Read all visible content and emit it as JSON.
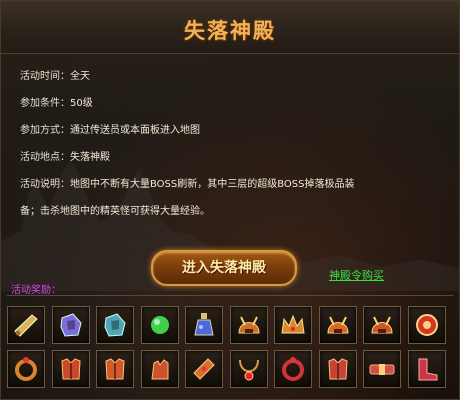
{
  "title": "失落神殿",
  "info_rows": [
    {
      "label": "活动时间：",
      "value": "全天"
    },
    {
      "label": "参加条件：",
      "value": "50级"
    },
    {
      "label": "参加方式：",
      "value": "通过传送员或本面板进入地图"
    },
    {
      "label": "活动地点：",
      "value": "失落神殿"
    },
    {
      "label": "活动说明：",
      "value": "地图中不断有大量BOSS刷新，其中三层的超级BOSS掉落极品装"
    },
    {
      "label": "",
      "value": "备；击杀地图中的精英怪可获得大量经验。"
    }
  ],
  "enter_button": "进入失落神殿",
  "buy_link": "神殿令购买",
  "reward_label": "活动奖励：",
  "rewards_row1": [
    {
      "icon": "golden-scroll-icon",
      "color": "#d9b45a"
    },
    {
      "icon": "purple-gem-icon",
      "color": "#7f6ad9"
    },
    {
      "icon": "teal-gem-icon",
      "color": "#4fa6b8"
    },
    {
      "icon": "green-orb-icon",
      "color": "#3fd14a"
    },
    {
      "icon": "potion-icon",
      "color": "#4b68e0"
    },
    {
      "icon": "helmet-icon",
      "color": "#c9702a"
    },
    {
      "icon": "crown-icon",
      "color": "#d8892e"
    },
    {
      "icon": "dragon-helm-icon",
      "color": "#d46a2a"
    },
    {
      "icon": "horned-helm-icon",
      "color": "#c85a26"
    },
    {
      "icon": "amulet-icon",
      "color": "#d2372a"
    }
  ],
  "rewards_row2": [
    {
      "icon": "ring-icon",
      "color": "#d9862e"
    },
    {
      "icon": "armor-icon",
      "color": "#c8482c"
    },
    {
      "icon": "dragon-armor-icon",
      "color": "#d05a2e"
    },
    {
      "icon": "gauntlet-icon",
      "color": "#c9542b"
    },
    {
      "icon": "bracer-icon",
      "color": "#d47030"
    },
    {
      "icon": "necklace-icon",
      "color": "#d8a23a"
    },
    {
      "icon": "red-bracelet-icon",
      "color": "#d1343a"
    },
    {
      "icon": "winged-armor-icon",
      "color": "#c8423a"
    },
    {
      "icon": "belt-icon",
      "color": "#cf4f4a"
    },
    {
      "icon": "boots-icon",
      "color": "#c9364a"
    }
  ]
}
